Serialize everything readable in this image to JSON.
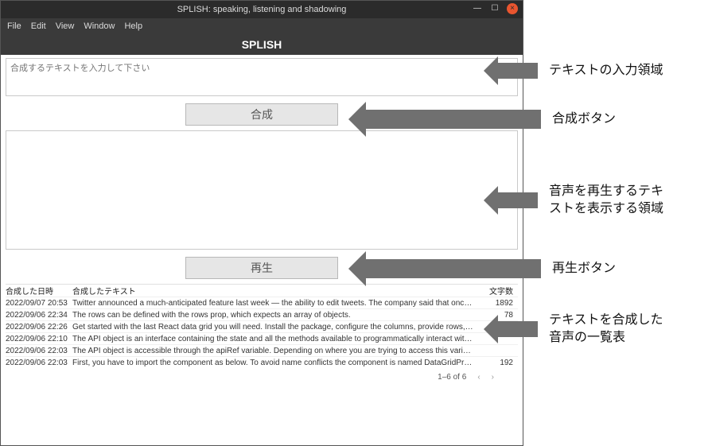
{
  "window": {
    "title": "SPLISH: speaking, listening and shadowing"
  },
  "menubar": {
    "file": "File",
    "edit": "Edit",
    "view": "View",
    "window": "Window",
    "help": "Help"
  },
  "header": {
    "title": "SPLISH"
  },
  "input": {
    "placeholder": "合成するテキストを入力して下さい",
    "value": ""
  },
  "buttons": {
    "synthesize": "合成",
    "play": "再生"
  },
  "display": {
    "value": ""
  },
  "grid": {
    "columns": {
      "date": "合成した日時",
      "text": "合成したテキスト",
      "chars": "文字数"
    },
    "rows": [
      {
        "date": "2022/09/07 20:53",
        "text": "Twitter announced a much-anticipated feature last week — the ability to edit tweets. The company said that once the feature is available use...",
        "chars": "1892"
      },
      {
        "date": "2022/09/06 22:34",
        "text": "The rows can be defined with the rows prop, which expects an array of objects.",
        "chars": "78"
      },
      {
        "date": "2022/09/06 22:26",
        "text": "Get started with the last React data grid you will need. Install the package, configure the columns, provide rows, and you are set.",
        "chars": ""
      },
      {
        "date": "2022/09/06 22:10",
        "text": "The API object is an interface containing the state and all the methods available to programmatically interact with the grid.",
        "chars": ""
      },
      {
        "date": "2022/09/06 22:03",
        "text": "The API object is accessible through the apiRef variable. Depending on where you are trying to access this variable, you will have to use ei...",
        "chars": ""
      },
      {
        "date": "2022/09/06 22:03",
        "text": "First, you have to import the component as below. To avoid name conflicts the component is named DataGridPro for the full-featured enterpris...",
        "chars": "192"
      }
    ],
    "footer": "1–6 of 6"
  },
  "annotations": {
    "a1": "テキストの入力領域",
    "a2": "合成ボタン",
    "a3_l1": "音声を再生するテキ",
    "a3_l2": "ストを表示する領域",
    "a4": "再生ボタン",
    "a5_l1": "テキストを合成した",
    "a5_l2": "音声の一覧表"
  }
}
